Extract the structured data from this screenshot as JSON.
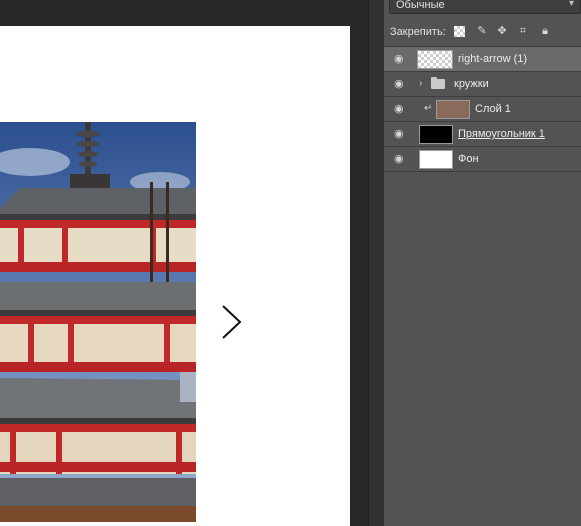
{
  "panel": {
    "blend_mode": "Обычные",
    "lock_label": "Закрепить:"
  },
  "layers": [
    {
      "name": "right-arrow (1)",
      "selected": true,
      "thumb": "checker-arrow"
    },
    {
      "name": "кружки",
      "type": "group"
    },
    {
      "name": "Слой 1",
      "clipped": true,
      "thumb": "photo"
    },
    {
      "name": "Прямоугольник 1",
      "thumb": "black-rect",
      "underlined": true
    },
    {
      "name": "Фон",
      "thumb": "white"
    }
  ],
  "colors": {
    "workspace": "#282828",
    "panel": "#535353",
    "selected_row": "#6a6a6a"
  },
  "icons": [
    "eye-icon",
    "lock-pixels-icon",
    "lock-brush-icon",
    "lock-move-icon",
    "lock-artboard-icon",
    "lock-all-icon",
    "folder-icon",
    "clip-icon",
    "chevron-right-icon",
    "chevron-down-icon",
    "right-arrow-icon"
  ]
}
